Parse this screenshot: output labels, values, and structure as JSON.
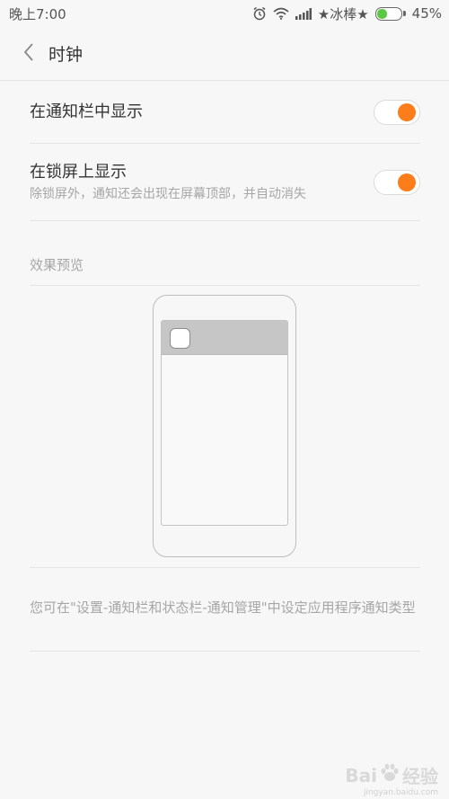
{
  "status_bar": {
    "time": "晚上7:00",
    "carrier": "★冰棒★",
    "battery_percent": "45%",
    "battery_level": 0.45,
    "icons": [
      "alarm-icon",
      "wifi-icon",
      "signal-icon",
      "battery-icon"
    ]
  },
  "header": {
    "back_icon": "chevron-left-icon",
    "title": "时钟"
  },
  "settings": {
    "notification_bar": {
      "label": "在通知栏中显示",
      "enabled": true
    },
    "lock_screen": {
      "label": "在锁屏上显示",
      "description": "除锁屏外，通知还会出现在屏幕顶部，并自动消失",
      "enabled": true
    }
  },
  "preview": {
    "label": "效果预览"
  },
  "footer_note": "您可在\"设置-通知栏和状态栏-通知管理\"中设定应用程序通知类型",
  "watermark": {
    "text_left": "Bai",
    "text_right": "经验",
    "site": "jingyan.baidu.com"
  },
  "colors": {
    "accent": "#fc7d19",
    "background": "#f7f7f7",
    "secondary_text": "#a6a6a6",
    "battery": "#5cc842"
  }
}
